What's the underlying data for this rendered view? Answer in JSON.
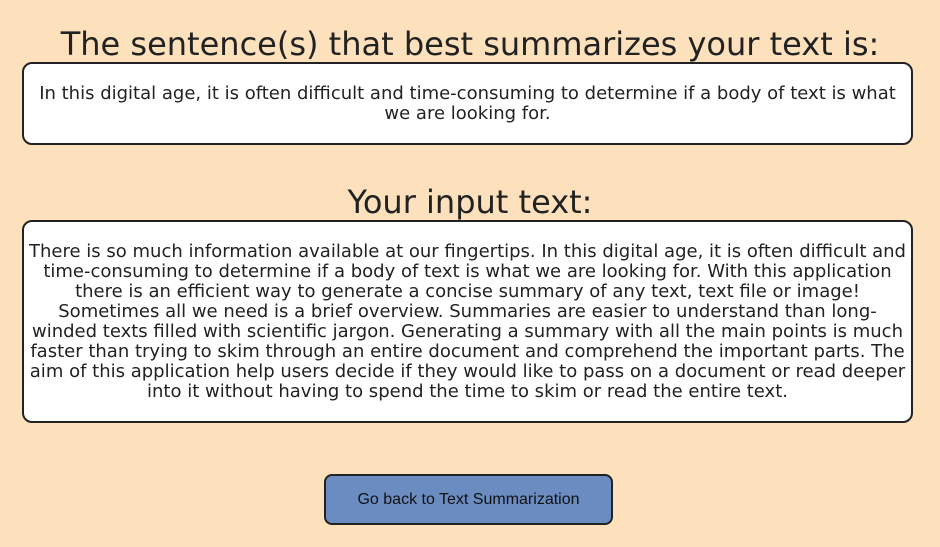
{
  "summary": {
    "heading": "The sentence(s) that best summarizes your text is:",
    "text": "In this digital age, it is often difficult and time-consuming to determine if a body of text is what we are looking for."
  },
  "input": {
    "heading": "Your input text:",
    "text": "There is so much information available at our fingertips. In this digital age, it is often difficult and time-consuming to determine if a body of text is what we are looking for. With this application there is an efficient way to generate a concise summary of any text, text file or image! Sometimes all we need is a brief overview. Summaries are easier to understand than long-winded texts filled with scientific jargon. Generating a summary with all the main points is much faster than trying to skim through an entire document and comprehend the important parts. The aim of this application help users decide if they would like to pass on a document or read deeper into it without having to spend the time to skim or read the entire text."
  },
  "actions": {
    "back_label": "Go back to Text Summarization"
  },
  "colors": {
    "background": "#fde1bd",
    "button": "#6a8cc1",
    "box": "#ffffff",
    "border": "#222222"
  }
}
